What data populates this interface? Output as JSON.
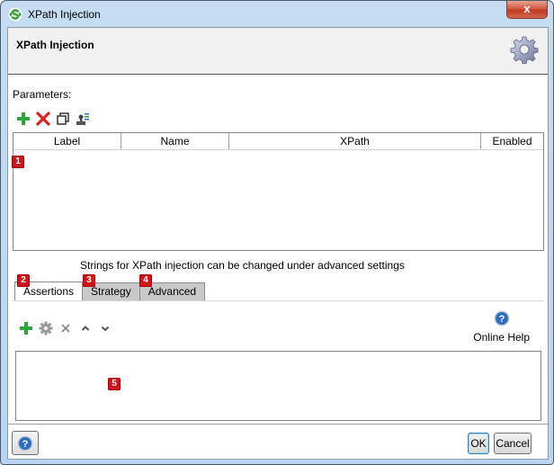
{
  "window": {
    "title": "XPath Injection",
    "close_label": "x"
  },
  "header": {
    "title": "XPath Injection",
    "icon": "gear-icon"
  },
  "parameters": {
    "label": "Parameters:",
    "toolbar": [
      {
        "name": "add-parameter-button",
        "icon": "plus-icon"
      },
      {
        "name": "remove-parameter-button",
        "icon": "red-x-icon"
      },
      {
        "name": "clone-parameter-button",
        "icon": "copy-icon"
      },
      {
        "name": "extract-parameter-button",
        "icon": "extract-icon"
      }
    ],
    "columns": [
      "Label",
      "Name",
      "XPath",
      "Enabled"
    ],
    "rows": []
  },
  "info_text": "Strings for XPath injection can be changed under advanced settings",
  "tabs": [
    {
      "label": "Assertions",
      "active": true,
      "badge": "2"
    },
    {
      "label": "Strategy",
      "active": false,
      "badge": "3"
    },
    {
      "label": "Advanced",
      "active": false,
      "badge": "4"
    }
  ],
  "assertions": {
    "toolbar": [
      {
        "name": "add-assertion-button",
        "icon": "plus-icon"
      },
      {
        "name": "configure-assertion-button",
        "icon": "gear-icon"
      },
      {
        "name": "remove-assertion-button",
        "icon": "x-icon"
      },
      {
        "name": "move-up-button",
        "icon": "chevron-up-icon"
      },
      {
        "name": "move-down-button",
        "icon": "chevron-down-icon"
      }
    ],
    "online_help_label": "Online Help",
    "items": []
  },
  "badges": {
    "params_table": "1",
    "assert_list": "5"
  },
  "footer": {
    "ok_label": "OK",
    "cancel_label": "Cancel"
  }
}
